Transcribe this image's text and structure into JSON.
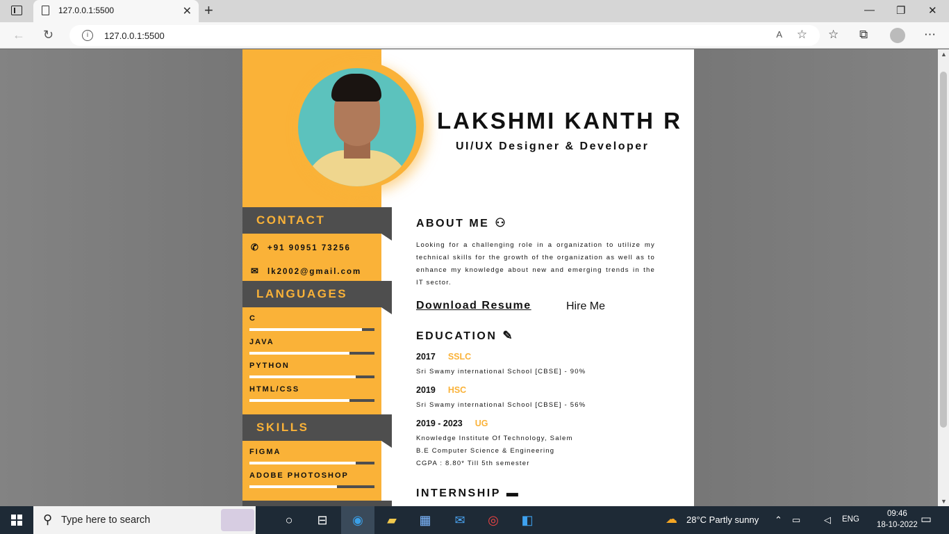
{
  "browser": {
    "tab_title": "127.0.0.1:5500",
    "url": "127.0.0.1:5500",
    "new_tab_label": "+",
    "close_tab_label": "✕",
    "read_aloud": "A"
  },
  "resume": {
    "name": "LAKSHMI KANTH R",
    "role": "UI/UX Designer & Developer",
    "contact": {
      "heading": "CONTACT",
      "phone": "+91 90951 73256",
      "email": "lk2002@gmail.com"
    },
    "languages": {
      "heading": "LANGUAGES",
      "items": [
        {
          "label": "C",
          "level": 0.9
        },
        {
          "label": "JAVA",
          "level": 0.8
        },
        {
          "label": "PYTHON",
          "level": 0.85
        },
        {
          "label": "HTML/CSS",
          "level": 0.8
        }
      ]
    },
    "skills": {
      "heading": "SKILLS",
      "items": [
        {
          "label": "FIGMA",
          "level": 0.85
        },
        {
          "label": "ADOBE PHOTOSHOP",
          "level": 0.7
        }
      ]
    },
    "about": {
      "heading": "ABOUT ME",
      "text": "Looking for a challenging role in a organization to utilize my technical skills for the growth of the organization as well as to enhance my knowledge about new and emerging trends in the IT sector."
    },
    "download_label": "Download Resume",
    "hire_label": "Hire Me",
    "education": {
      "heading": "EDUCATION",
      "items": [
        {
          "year": "2017",
          "degree": "SSLC",
          "lines": [
            "Sri Swamy international School [CBSE] - 90%"
          ]
        },
        {
          "year": "2019",
          "degree": "HSC",
          "lines": [
            "Sri Swamy international School [CBSE] - 56%"
          ]
        },
        {
          "year": "2019 - 2023",
          "degree": "UG",
          "lines": [
            "Knowledge Institute Of Technology, Salem",
            "B.E Computer Science & Engineering",
            "CGPA : 8.80* Till 5th semester"
          ]
        }
      ]
    },
    "internship": {
      "heading": "INTERNSHIP"
    }
  },
  "taskbar": {
    "search_placeholder": "Type here to search",
    "weather": "28°C  Partly sunny",
    "language": "ENG",
    "time": "09:46",
    "date": "18-10-2022"
  }
}
